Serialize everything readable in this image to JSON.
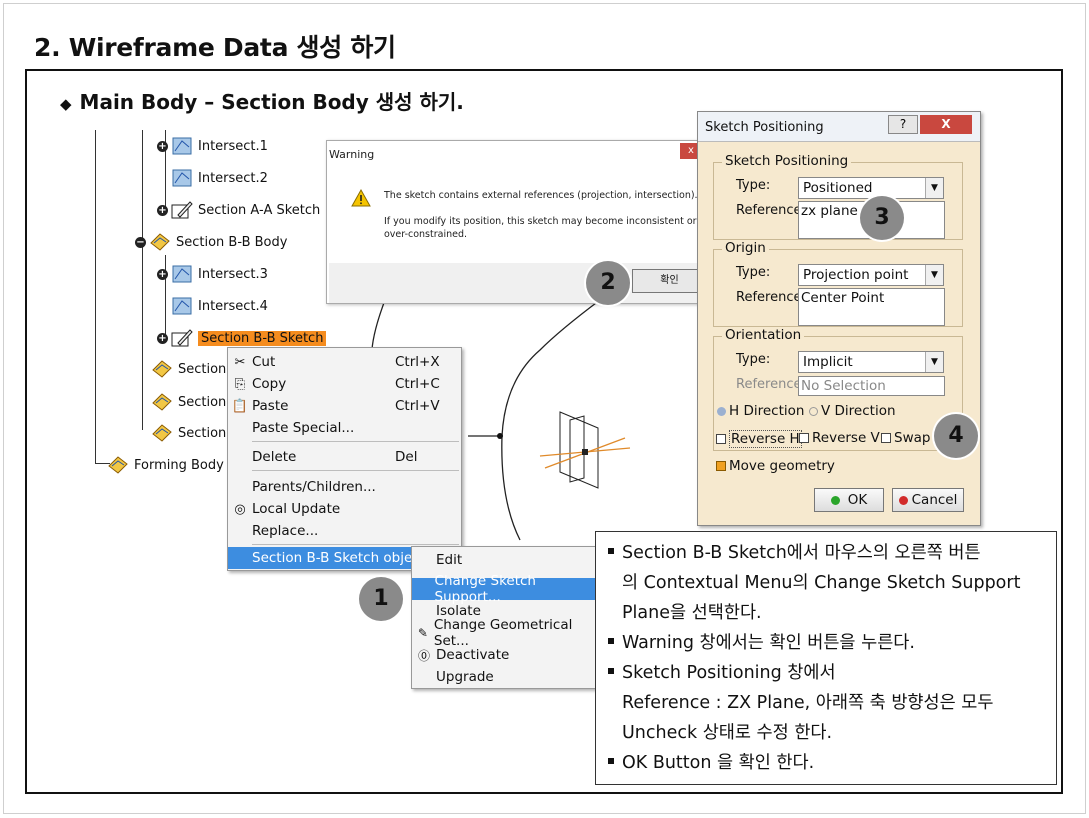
{
  "page": {
    "title": "2. Wireframe Data 생성 하기",
    "subtitle_bullet": "◆",
    "subtitle": "Main Body – Section Body 생성 하기."
  },
  "tree": {
    "nodes": [
      {
        "label": "Intersect.1"
      },
      {
        "label": "Intersect.2"
      },
      {
        "label": "Section A-A Sketch"
      },
      {
        "label": "Section B-B Body"
      },
      {
        "label": "Intersect.3"
      },
      {
        "label": "Intersect.4"
      },
      {
        "label": "Section B-B Sketch"
      },
      {
        "label": "Section"
      },
      {
        "label": "Section"
      },
      {
        "label": "Section"
      },
      {
        "label": "Forming Body"
      }
    ]
  },
  "context_menu": {
    "items": [
      {
        "label": "Cut",
        "shortcut": "Ctrl+X"
      },
      {
        "label": "Copy",
        "shortcut": "Ctrl+C"
      },
      {
        "label": "Paste",
        "shortcut": "Ctrl+V"
      },
      {
        "label": "Paste Special...",
        "shortcut": ""
      },
      {
        "label": "Delete",
        "shortcut": "Del"
      },
      {
        "label": "Parents/Children...",
        "shortcut": ""
      },
      {
        "label": "Local Update",
        "shortcut": ""
      },
      {
        "label": "Replace...",
        "shortcut": ""
      },
      {
        "label": "Section B-B Sketch object",
        "shortcut": ""
      }
    ]
  },
  "submenu": {
    "items": [
      {
        "label": "Edit"
      },
      {
        "label": "Change Sketch Support..."
      },
      {
        "label": "Isolate"
      },
      {
        "label": "Change Geometrical Set..."
      },
      {
        "label": "Deactivate"
      },
      {
        "label": "Upgrade"
      }
    ]
  },
  "warning_dialog": {
    "title": "Warning",
    "close": "x",
    "line1": "The sketch contains external references (projection, intersection).",
    "line2": "If you modify its position, this sketch may become inconsistent or",
    "line3": "over-constrained.",
    "ok_button": "확인",
    "icon": "warning-triangle-icon"
  },
  "sketch_positioning": {
    "title": "Sketch Positioning",
    "help": "?",
    "close": "X",
    "group1": {
      "title": "Sketch Positioning",
      "type_label": "Type:",
      "type_value": "Positioned",
      "ref_label": "Reference:",
      "ref_value": "zx plane"
    },
    "group2": {
      "title": "Origin",
      "type_label": "Type:",
      "type_value": "Projection point",
      "ref_label": "Reference:",
      "ref_value": "Center Point"
    },
    "group3": {
      "title": "Orientation",
      "type_label": "Type:",
      "type_value": "Implicit",
      "ref_label": "Reference:",
      "ref_value": "No Selection"
    },
    "h_direction": "H Direction",
    "v_direction": "V Direction",
    "reverse_h": "Reverse H",
    "reverse_v": "Reverse V",
    "swap": "Swap",
    "move_geometry": "Move geometry",
    "ok": "OK",
    "cancel": "Cancel",
    "ok_dot_color": "#2aa52a",
    "cancel_dot_color": "#d22b2b"
  },
  "step_markers": [
    "1",
    "2",
    "3",
    "4"
  ],
  "notes": {
    "bullet1_l1": "Section B-B Sketch에서 마우스의 오른쪽 버튼",
    "bullet1_l2": "의 Contextual Menu의 Change Sketch Support",
    "bullet1_l3": "Plane을 선택한다.",
    "bullet2": "Warning 창에서는 확인 버튼을 누른다.",
    "bullet3_l1": "Sketch Positioning 창에서",
    "bullet3_l2": "Reference : ZX Plane, 아래쪽 축 방향성은 모두",
    "bullet3_l3": "Uncheck 상태로 수정 한다.",
    "bullet4": "OK Button 을 확인 한다."
  },
  "colors": {
    "selection_orange": "#f58c1e",
    "menu_highlight": "#3d8de0",
    "dialog_beige": "#f6e9cf",
    "marker_gray": "#8a8a8a"
  }
}
